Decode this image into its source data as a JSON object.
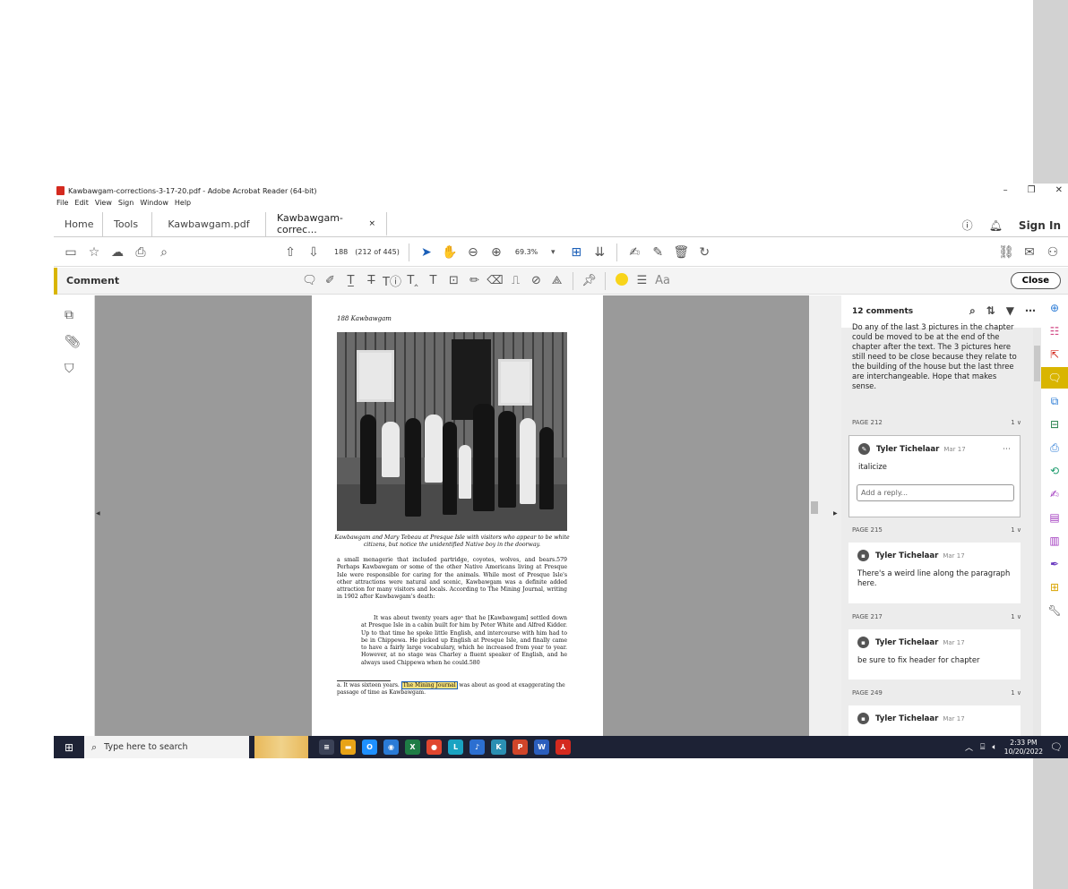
{
  "window": {
    "title": "Kawbawgam-corrections-3-17-20.pdf - Adobe Acrobat Reader (64-bit)",
    "controls": [
      "–",
      "❐",
      "✕"
    ]
  },
  "menu": [
    "File",
    "Edit",
    "View",
    "Sign",
    "Window",
    "Help"
  ],
  "tabs": {
    "home": "Home",
    "tools": "Tools",
    "doc1": "Kawbawgam.pdf",
    "doc2": "Kawbawgam-correc...",
    "doc2_close": "×",
    "signin": "Sign In"
  },
  "toolbar": {
    "page_number": "188",
    "page_of": "(212 of 445)",
    "zoom": "69.3%"
  },
  "comment_bar": {
    "label": "Comment",
    "font_label": "Aa",
    "close": "Close",
    "color_accent": "#d9b500",
    "color_swatch": "#f8d41a"
  },
  "document": {
    "running_head": "188  Kawbawgam",
    "caption": "Kawbawgam and Mary Tebeau at Presque Isle with visitors who appear to be white citizens, but notice the unidentified Native boy in the doorway.",
    "body": "a small menagerie that included partridge, coyotes, wolves, and bears.579 Perhaps Kawbawgam or some of the other Native Americans living at Presque Isle were responsible for caring for the animals. While most of Presque Isle's other attractions were natural and scenic, Kawbawgam was a definite added attraction for many visitors and locals. According to The Mining Journal, writing in 1902 after Kawbawgam's death:",
    "quote": "It was about twenty years agoᵃ that he [Kawbawgam] settled down at Presque Isle in a cabin built for him by Peter White and Alfred Kidder. Up to that time he spoke little English, and intercourse with him had to be in Chippewa. He picked up English at Presque Isle, and finally came to have a fairly large vocabulary, which he increased from year to year. However, at no stage was Charley a fluent speaker of English, and he always used Chippewa when he could.580",
    "footnote_pre": "a.  It was sixteen years. ",
    "footnote_highlight": "The Mining Journal",
    "footnote_post": " was about as good at exaggerating the passage of time as Kawbawgam.",
    "highlight_color": "#f8e27a"
  },
  "comments": {
    "count_label": "12 comments",
    "prev_text": "Do any of the last 3 pictures in the chapter could be moved to be at the end of the chapter after the text. The 3 pictures here still need to be close because they relate to the building of the house but the last three are interchangeable. Hope that makes sense.",
    "groups": [
      {
        "page": "PAGE 212",
        "count": "1 ∨",
        "author": "Tyler Tichelaar",
        "date": "Mar 17",
        "text": "italicize",
        "reply_placeholder": "Add a reply..."
      },
      {
        "page": "PAGE 215",
        "count": "1 ∨",
        "author": "Tyler Tichelaar",
        "date": "Mar 17",
        "text": "There's a weird line along the paragraph here."
      },
      {
        "page": "PAGE 217",
        "count": "1 ∨",
        "author": "Tyler Tichelaar",
        "date": "Mar 17",
        "text": "be sure to fix header for chapter"
      },
      {
        "page": "PAGE 249",
        "count": "1 ∨",
        "author": "Tyler Tichelaar",
        "date": "Mar 17",
        "text": ""
      }
    ]
  },
  "taskbar": {
    "search_placeholder": "Type here to search",
    "time": "2:33 PM",
    "date": "10/20/2022",
    "apps": [
      {
        "glyph": "≡",
        "color": "#3b4257"
      },
      {
        "glyph": "▬",
        "color": "#e8a317"
      },
      {
        "glyph": "O",
        "color": "#1e90ff"
      },
      {
        "glyph": "◉",
        "color": "#2a7bd6"
      },
      {
        "glyph": "X",
        "color": "#1e7c45"
      },
      {
        "glyph": "●",
        "color": "#e0462f"
      },
      {
        "glyph": "L",
        "color": "#1aa3c2"
      },
      {
        "glyph": "♪",
        "color": "#2c6fd1"
      },
      {
        "glyph": "K",
        "color": "#2b8fb3"
      },
      {
        "glyph": "P",
        "color": "#d0452a"
      },
      {
        "glyph": "W",
        "color": "#2b5ebd"
      },
      {
        "glyph": "⅄",
        "color": "#d42a1f"
      }
    ]
  }
}
